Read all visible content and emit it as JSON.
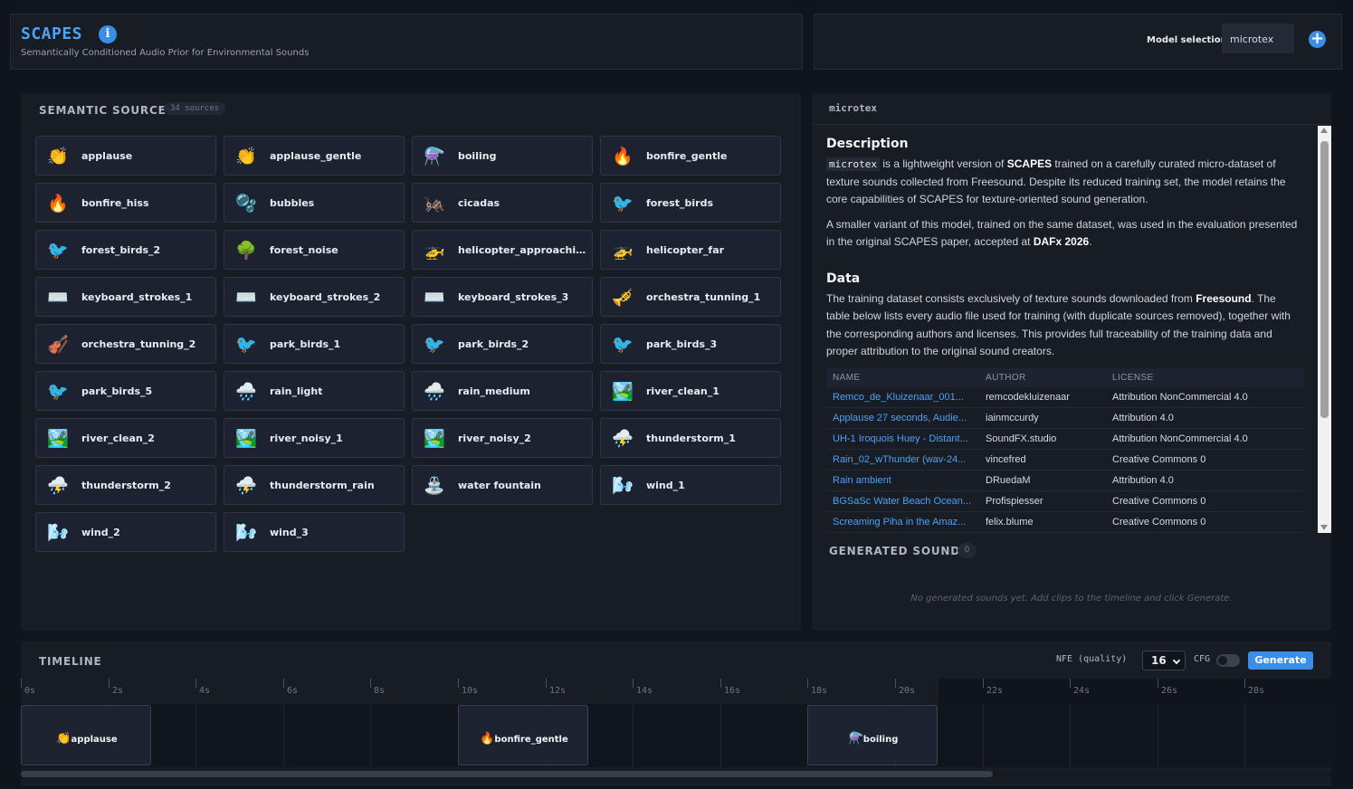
{
  "header": {
    "title": "SCAPES",
    "subtitle": "Semantically Conditioned Audio Prior for Environmental Sounds",
    "model_label": "Model selection",
    "model_value": "microtex"
  },
  "sources": {
    "title": "SEMANTIC SOURCES",
    "count": "34 sources",
    "items": [
      {
        "label": "applause",
        "emoji": "👏"
      },
      {
        "label": "applause_gentle",
        "emoji": "👏"
      },
      {
        "label": "boiling",
        "emoji": "⚗️"
      },
      {
        "label": "bonfire_gentle",
        "emoji": "🔥"
      },
      {
        "label": "bonfire_hiss",
        "emoji": "🔥"
      },
      {
        "label": "bubbles",
        "emoji": "🫧"
      },
      {
        "label": "cicadas",
        "emoji": "🦗"
      },
      {
        "label": "forest_birds",
        "emoji": "🐦"
      },
      {
        "label": "forest_birds_2",
        "emoji": "🐦"
      },
      {
        "label": "forest_noise",
        "emoji": "🌳"
      },
      {
        "label": "helicopter_approachi...",
        "emoji": "🚁"
      },
      {
        "label": "helicopter_far",
        "emoji": "🚁"
      },
      {
        "label": "keyboard_strokes_1",
        "emoji": "⌨️"
      },
      {
        "label": "keyboard_strokes_2",
        "emoji": "⌨️"
      },
      {
        "label": "keyboard_strokes_3",
        "emoji": "⌨️"
      },
      {
        "label": "orchestra_tunning_1",
        "emoji": "🎺"
      },
      {
        "label": "orchestra_tunning_2",
        "emoji": "🎻"
      },
      {
        "label": "park_birds_1",
        "emoji": "🐦"
      },
      {
        "label": "park_birds_2",
        "emoji": "🐦"
      },
      {
        "label": "park_birds_3",
        "emoji": "🐦"
      },
      {
        "label": "park_birds_5",
        "emoji": "🐦"
      },
      {
        "label": "rain_light",
        "emoji": "🌧️"
      },
      {
        "label": "rain_medium",
        "emoji": "🌧️"
      },
      {
        "label": "river_clean_1",
        "emoji": "🏞️"
      },
      {
        "label": "river_clean_2",
        "emoji": "🏞️"
      },
      {
        "label": "river_noisy_1",
        "emoji": "🏞️"
      },
      {
        "label": "river_noisy_2",
        "emoji": "🏞️"
      },
      {
        "label": "thunderstorm_1",
        "emoji": "⛈️"
      },
      {
        "label": "thunderstorm_2",
        "emoji": "⛈️"
      },
      {
        "label": "thunderstorm_rain",
        "emoji": "⛈️"
      },
      {
        "label": "water fountain",
        "emoji": "⛲"
      },
      {
        "label": "wind_1",
        "emoji": "🌬️"
      },
      {
        "label": "wind_2",
        "emoji": "🌬️"
      },
      {
        "label": "wind_3",
        "emoji": "🌬️"
      }
    ]
  },
  "detail": {
    "name": "microtex",
    "description_heading": "Description",
    "desc_p1_code": "microtex",
    "desc_p1_a": " is a lightweight version of ",
    "desc_p1_b": "SCAPES",
    "desc_p1_c": " trained on a carefully curated micro-dataset of texture sounds collected from Freesound. Despite its reduced training set, the model retains the core capabilities of SCAPES for texture-oriented sound generation.",
    "desc_p2_a": "A smaller variant of this model, trained on the same dataset, was used in the evaluation presented in the original SCAPES paper, accepted at ",
    "desc_p2_b": "DAFx 2026",
    "desc_p2_c": ".",
    "data_heading": "Data",
    "data_p_a": "The training dataset consists exclusively of texture sounds downloaded from ",
    "data_p_b": "Freesound",
    "data_p_c": ". The table below lists every audio file used for training (with duplicate sources removed), together with the corresponding authors and licenses. This provides full traceability of the training data and proper attribution to the original sound creators.",
    "table_headers": [
      "NAME",
      "AUTHOR",
      "LICENSE"
    ],
    "table_rows": [
      [
        "Remco_de_Kluizenaar_001...",
        "remcodekluizenaar",
        "Attribution NonCommercial 4.0"
      ],
      [
        "Applause 27 seconds, Audie...",
        "iainmccurdy",
        "Attribution 4.0"
      ],
      [
        "UH-1 Iroquois Huey - Distant...",
        "SoundFX.studio",
        "Attribution NonCommercial 4.0"
      ],
      [
        "Rain_02_wThunder (wav-24...",
        "vincefred",
        "Creative Commons 0"
      ],
      [
        "Rain ambient",
        "DRuedaM",
        "Attribution 4.0"
      ],
      [
        "BGSaSc Water Beach Ocean...",
        "Profispiesser",
        "Creative Commons 0"
      ],
      [
        "Screaming Piha in the Amaz...",
        "felix.blume",
        "Creative Commons 0"
      ]
    ]
  },
  "generated": {
    "title": "GENERATED SOUNDS",
    "count": "0",
    "empty": "No generated sounds yet. Add clips to the timeline and click Generate."
  },
  "timeline": {
    "title": "TIMELINE",
    "nfe_label": "NFE (quality)",
    "nfe_value": "16",
    "cfg_label": "CFG",
    "cfg_enabled": false,
    "generate_label": "Generate",
    "ticks": [
      "0s",
      "2s",
      "4s",
      "6s",
      "8s",
      "10s",
      "12s",
      "14s",
      "16s",
      "18s",
      "20s",
      "22s",
      "24s",
      "26s",
      "28s"
    ],
    "clips": [
      {
        "label": "applause",
        "emoji": "👏",
        "start": 0,
        "end": 3
      },
      {
        "label": "bonfire_gentle",
        "emoji": "🔥",
        "start": 10,
        "end": 13
      },
      {
        "label": "boiling",
        "emoji": "⚗️",
        "start": 18,
        "end": 21
      }
    ]
  },
  "colors": {
    "accent": "#3b8ee8",
    "title": "#4ea1f3",
    "panel": "#171c25",
    "background": "#10141c"
  }
}
